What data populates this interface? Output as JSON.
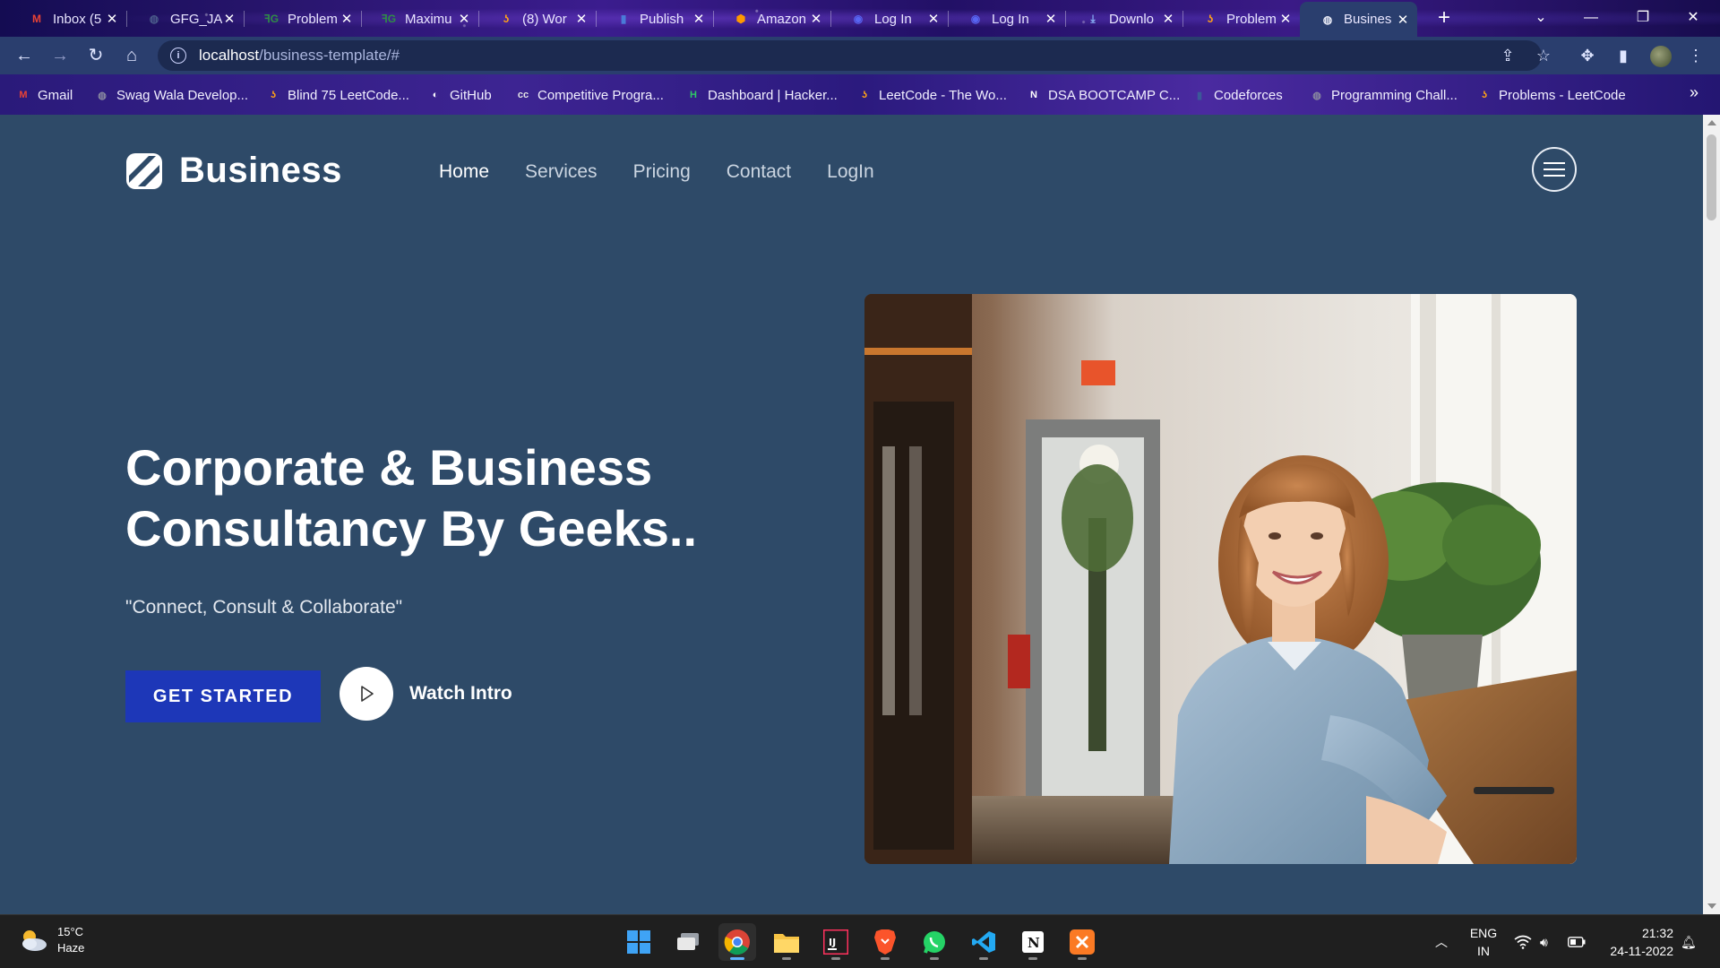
{
  "browser": {
    "tabs": [
      {
        "title": "Inbox (5",
        "icon": "gmail-icon",
        "color": "#ea4335",
        "active": false
      },
      {
        "title": "GFG_JA",
        "icon": "globe-icon",
        "color": "#4a5a8a",
        "active": false
      },
      {
        "title": "Problem",
        "icon": "gfg-icon",
        "color": "#2f8d46",
        "active": false
      },
      {
        "title": "Maximu",
        "icon": "gfg-icon",
        "color": "#2f8d46",
        "active": false
      },
      {
        "title": "(8) Wor",
        "icon": "leetcode-icon",
        "color": "#ffa116",
        "active": false
      },
      {
        "title": "Publish",
        "icon": "bar-chart-icon",
        "color": "#4a7bd8",
        "active": false
      },
      {
        "title": "Amazon",
        "icon": "aws-icon",
        "color": "#ff9900",
        "active": false
      },
      {
        "title": "Log In",
        "icon": "discord-icon",
        "color": "#5865f2",
        "active": false
      },
      {
        "title": "Log In",
        "icon": "discord-icon",
        "color": "#5865f2",
        "active": false
      },
      {
        "title": "Downlo",
        "icon": "download-icon",
        "color": "#8ab4f8",
        "active": false
      },
      {
        "title": "Problem",
        "icon": "leetcode-icon",
        "color": "#ffa116",
        "active": false
      },
      {
        "title": "Busines",
        "icon": "globe-icon",
        "color": "#e8eaf6",
        "active": true
      }
    ],
    "new_tab_label": "+",
    "url_host": "localhost",
    "url_path": "/business-template/#",
    "bookmarks": [
      {
        "label": "Gmail",
        "icon": "gmail-icon",
        "color": "#ea4335"
      },
      {
        "label": "Swag Wala Develop...",
        "icon": "globe-icon",
        "color": "#8a8aa0"
      },
      {
        "label": "Blind 75 LeetCode...",
        "icon": "leetcode-icon",
        "color": "#ffa116"
      },
      {
        "label": "GitHub",
        "icon": "github-icon",
        "color": "#ffffff"
      },
      {
        "label": "Competitive Progra...",
        "icon": "codechef-icon",
        "color": "#e6e6e6"
      },
      {
        "label": "Dashboard | Hacker...",
        "icon": "hackerrank-icon",
        "color": "#2ec866"
      },
      {
        "label": "LeetCode - The Wo...",
        "icon": "leetcode-icon",
        "color": "#ffa116"
      },
      {
        "label": "DSA BOOTCAMP C...",
        "icon": "notion-icon",
        "color": "#ffffff"
      },
      {
        "label": "Codeforces",
        "icon": "codeforces-icon",
        "color": "#3b5998"
      },
      {
        "label": "Programming Chall...",
        "icon": "globe-icon",
        "color": "#8a8aa0"
      },
      {
        "label": "Problems - LeetCode",
        "icon": "leetcode-icon",
        "color": "#ffa116"
      }
    ],
    "bookmarks_overflow": "»"
  },
  "site": {
    "brand": "Business",
    "nav": [
      {
        "label": "Home",
        "active": true
      },
      {
        "label": "Services",
        "active": false
      },
      {
        "label": "Pricing",
        "active": false
      },
      {
        "label": "Contact",
        "active": false
      },
      {
        "label": "LogIn",
        "active": false
      }
    ],
    "hero": {
      "title_line1": "Corporate & Business",
      "title_line2": "Consultancy By Geeks..",
      "tagline": "\"Connect, Consult & Collaborate\"",
      "cta_label": "GET STARTED",
      "watch_label": "Watch Intro"
    },
    "colors": {
      "page_bg": "#2e4a68",
      "cta_bg": "#1d37b8",
      "text": "#ffffff"
    }
  },
  "taskbar": {
    "weather_temp": "15°C",
    "weather_desc": "Haze",
    "apps": [
      {
        "name": "start-icon",
        "active": false
      },
      {
        "name": "task-view-icon",
        "active": false
      },
      {
        "name": "chrome-icon",
        "active": true
      },
      {
        "name": "file-explorer-icon",
        "active": false
      },
      {
        "name": "intellij-icon",
        "active": false
      },
      {
        "name": "brave-icon",
        "active": false
      },
      {
        "name": "whatsapp-icon",
        "active": false
      },
      {
        "name": "vscode-icon",
        "active": false
      },
      {
        "name": "notion-icon",
        "active": false
      },
      {
        "name": "xampp-icon",
        "active": false
      }
    ],
    "lang_line1": "ENG",
    "lang_line2": "IN",
    "time": "21:32",
    "date": "24-11-2022"
  }
}
